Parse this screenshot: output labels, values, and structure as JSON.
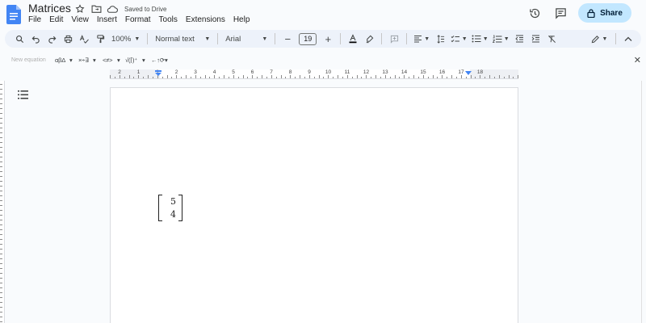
{
  "app": {
    "doc_title": "Matrices",
    "save_status": "Saved to Drive",
    "share_label": "Share",
    "accent": "#c2e7ff",
    "doc_icon_color": "#4285f4"
  },
  "menu": [
    "File",
    "Edit",
    "View",
    "Insert",
    "Format",
    "Tools",
    "Extensions",
    "Help"
  ],
  "toolbar": {
    "zoom": "100%",
    "style": "Normal text",
    "font": "Arial",
    "font_size": "19"
  },
  "equation_bar": {
    "new_equation": "New equation",
    "groups": [
      "αβΔ",
      "×÷∃",
      "<≠>",
      "√(⌈)⁺",
      "←↑⟳"
    ]
  },
  "ruler": {
    "numbers": [
      "2",
      "1",
      "1",
      "2",
      "3",
      "4",
      "5",
      "6",
      "7",
      "8",
      "9",
      "10",
      "11",
      "12",
      "13",
      "14",
      "15",
      "16",
      "17",
      "18"
    ]
  },
  "document": {
    "matrix": [
      "5",
      "4"
    ]
  }
}
